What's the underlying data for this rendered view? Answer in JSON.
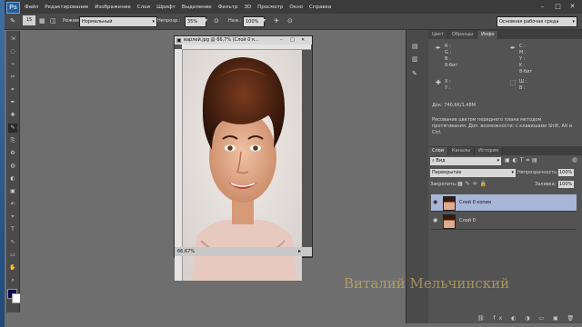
{
  "menu": [
    "Файл",
    "Редактирование",
    "Изображение",
    "Слои",
    "Шрифт",
    "Выделение",
    "Фильтр",
    "3D",
    "Просмотр",
    "Окно",
    "Справка"
  ],
  "app_logo": "Ps",
  "options": {
    "brush_size": "15",
    "mode_label": "Режим:",
    "mode_value": "Нормальный",
    "opacity_label": "Непрозр.:",
    "opacity_value": "35%",
    "flow_label": "Наж.:",
    "flow_value": "100%"
  },
  "workspace": "Основная рабочая среда",
  "document": {
    "title": "варлей.jpg @ 66,7% (Слой 0 к...",
    "zoom": "66,67%"
  },
  "info_panel": {
    "tabs": [
      "Цвет",
      "Образцы",
      "Инфо"
    ],
    "active_tab": "Инфо",
    "labels_left": [
      "R :",
      "G :",
      "B :",
      "8-бит"
    ],
    "labels_right": [
      "C :",
      "M :",
      "Y :",
      "K :",
      "8-бит"
    ],
    "xy": [
      "X :",
      "Y :"
    ],
    "wh": [
      "Ш :",
      "В :"
    ],
    "doc_size": "Док: 740,6K/1,48M",
    "hint": "Рисование цветом переднего плана методом протягивания. Доп. возможности: с клавишами Shift, Alt и Ctrl."
  },
  "layers_panel": {
    "tabs": [
      "Слои",
      "Каналы",
      "История"
    ],
    "active_tab": "Слои",
    "filter_value": "Вид",
    "blend_mode": "Перекрытие",
    "opacity_label": "Непрозрачность:",
    "opacity_value": "100%",
    "lock_label": "Закрепить:",
    "fill_label": "Заливка:",
    "fill_value": "100%",
    "layers": [
      {
        "name": "Слой 0 копия",
        "selected": true
      },
      {
        "name": "Слой 0",
        "selected": false
      }
    ]
  },
  "watermark": "Виталий Мельчинский",
  "colors": {
    "accent_selection": "#a7b6d6",
    "watermark": "#c9b060"
  }
}
